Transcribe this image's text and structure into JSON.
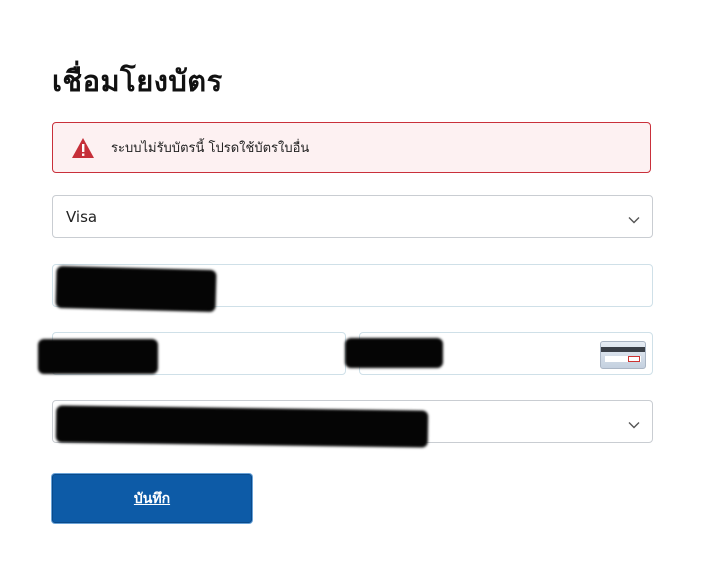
{
  "page": {
    "title": "เชื่อมโยงบัตร"
  },
  "alert": {
    "icon": "warning-triangle-icon",
    "message": "ระบบไม่รับบัตรนี้ โปรดใช้บัตรใบอื่น",
    "border_color": "#c9303b",
    "background_color": "#fdf1f2"
  },
  "form": {
    "card_type": {
      "value": "Visa",
      "icon": "chevron-down-icon"
    },
    "card_number": {
      "value": "",
      "redacted": true
    },
    "expiry": {
      "value": "",
      "redacted": true
    },
    "cvv": {
      "value": "",
      "redacted": true,
      "icon": "card-cvv-icon"
    },
    "bottom_select": {
      "value": "",
      "redacted": true,
      "icon": "chevron-down-icon"
    },
    "save_label": "บันทึก",
    "save_color": "#0d5ba7"
  }
}
